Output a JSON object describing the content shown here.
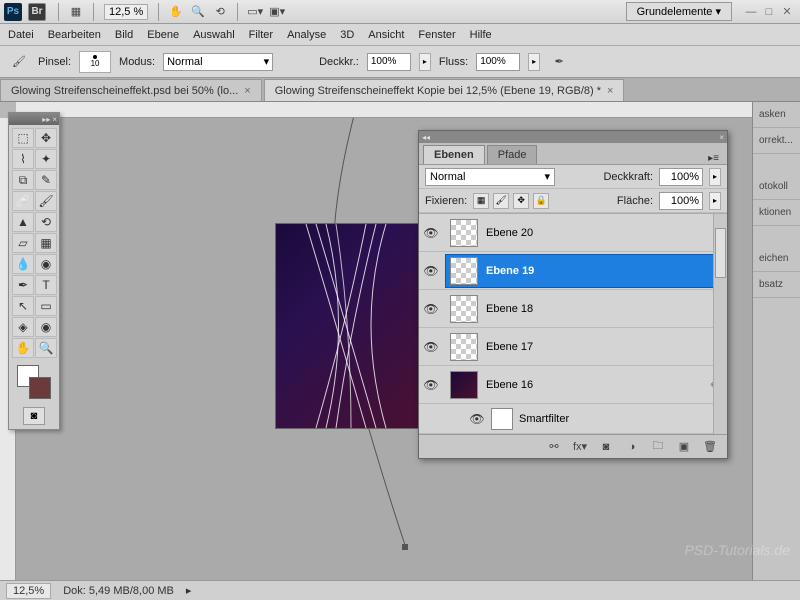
{
  "appbar": {
    "ps": "Ps",
    "br": "Br",
    "zoom": "12,5 %",
    "workspace": "Grundelemente ▾"
  },
  "menu": [
    "Datei",
    "Bearbeiten",
    "Bild",
    "Ebene",
    "Auswahl",
    "Filter",
    "Analyse",
    "3D",
    "Ansicht",
    "Fenster",
    "Hilfe"
  ],
  "options": {
    "brush_label": "Pinsel:",
    "brush_size": "10",
    "mode_label": "Modus:",
    "mode_value": "Normal",
    "opacity_label": "Deckkr.:",
    "opacity_value": "100%",
    "flow_label": "Fluss:",
    "flow_value": "100%"
  },
  "tabs": [
    {
      "label": "Glowing Streifenscheineffekt.psd bei 50% (lo...",
      "active": false
    },
    {
      "label": "Glowing Streifenscheineffekt Kopie bei 12,5% (Ebene 19, RGB/8) *",
      "active": true
    }
  ],
  "layers_panel": {
    "tab1": "Ebenen",
    "tab2": "Pfade",
    "blend_mode": "Normal",
    "opacity_label": "Deckkraft:",
    "opacity": "100%",
    "lock_label": "Fixieren:",
    "fill_label": "Fläche:",
    "fill": "100%",
    "layers": [
      {
        "name": "Ebene 20",
        "selected": false,
        "visible": true,
        "thumb": "checker"
      },
      {
        "name": "Ebene 19",
        "selected": true,
        "visible": true,
        "thumb": "checker"
      },
      {
        "name": "Ebene 18",
        "selected": false,
        "visible": true,
        "thumb": "checker"
      },
      {
        "name": "Ebene 17",
        "selected": false,
        "visible": true,
        "thumb": "checker"
      },
      {
        "name": "Ebene 16",
        "selected": false,
        "visible": true,
        "thumb": "dark"
      }
    ],
    "smartfilter": "Smartfilter"
  },
  "dock": [
    "asken",
    "orrekt...",
    "otokoll",
    "ktionen",
    "eichen",
    "bsatz"
  ],
  "status": {
    "zoom": "12,5%",
    "doc": "Dok: 5,49 MB/8,00 MB"
  },
  "watermark": "PSD-Tutorials.de"
}
